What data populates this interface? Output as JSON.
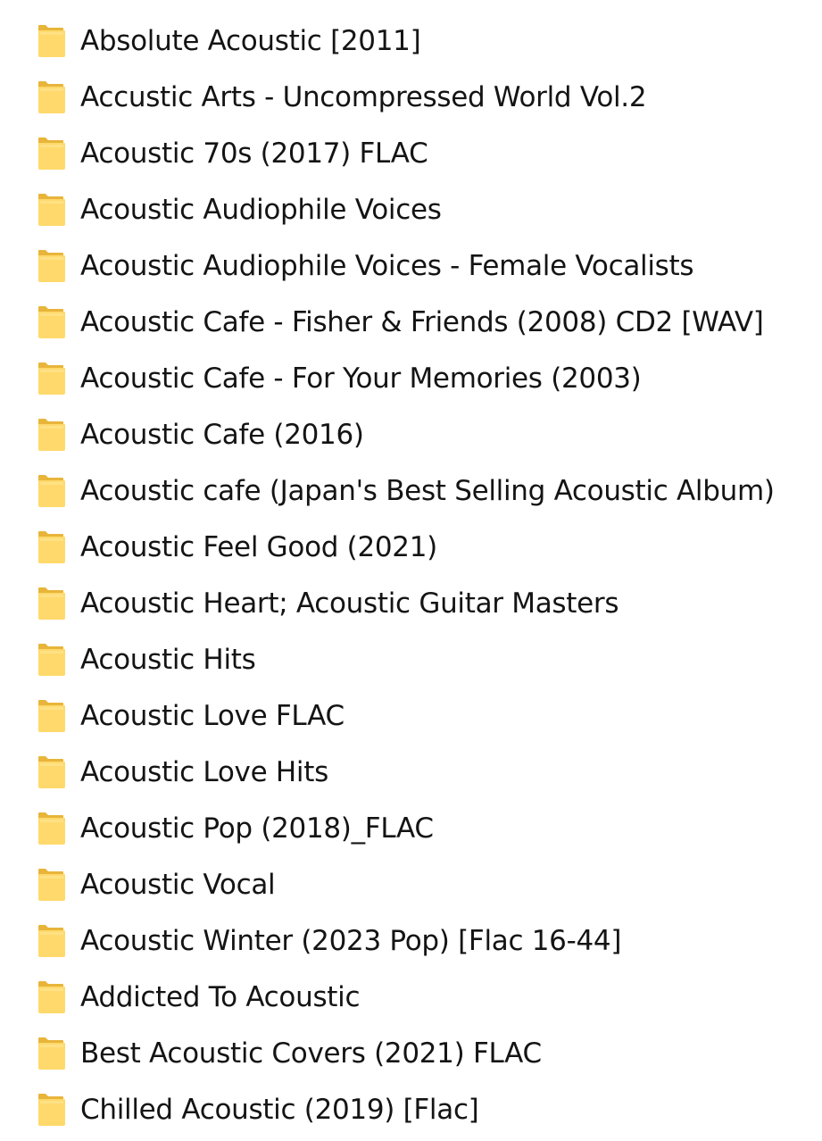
{
  "folders": [
    {
      "name": "Absolute Acoustic [2011]",
      "icon": "folder-icon"
    },
    {
      "name": "Accustic Arts - Uncompressed World Vol.2",
      "icon": "folder-icon"
    },
    {
      "name": "Acoustic 70s (2017) FLAC",
      "icon": "folder-icon"
    },
    {
      "name": "Acoustic Audiophile Voices",
      "icon": "folder-icon"
    },
    {
      "name": "Acoustic Audiophile Voices  - Female Vocalists",
      "icon": "folder-icon"
    },
    {
      "name": "Acoustic Cafe - Fisher & Friends (2008) CD2 [WAV]",
      "icon": "folder-icon"
    },
    {
      "name": "Acoustic Cafe - For Your Memories (2003)",
      "icon": "folder-icon"
    },
    {
      "name": "Acoustic Cafe (2016)",
      "icon": "folder-icon"
    },
    {
      "name": "Acoustic cafe (Japan's Best Selling Acoustic Album)",
      "icon": "folder-icon"
    },
    {
      "name": "Acoustic Feel Good (2021)",
      "icon": "folder-icon"
    },
    {
      "name": "Acoustic Heart; Acoustic Guitar Masters",
      "icon": "folder-icon"
    },
    {
      "name": "Acoustic Hits",
      "icon": "folder-icon"
    },
    {
      "name": "Acoustic Love FLAC",
      "icon": "folder-icon"
    },
    {
      "name": "Acoustic Love Hits",
      "icon": "folder-icon"
    },
    {
      "name": "Acoustic Pop (2018)_FLAC",
      "icon": "folder-icon"
    },
    {
      "name": "Acoustic Vocal",
      "icon": "folder-icon"
    },
    {
      "name": "Acoustic Winter (2023 Pop) [Flac 16-44]",
      "icon": "folder-icon"
    },
    {
      "name": "Addicted To Acoustic",
      "icon": "folder-icon"
    },
    {
      "name": "Best Acoustic Covers (2021) FLAC",
      "icon": "folder-icon"
    },
    {
      "name": "Chilled Acoustic (2019) [Flac]",
      "icon": "folder-icon"
    }
  ],
  "colors": {
    "folder_back": "#E8B53A",
    "folder_front": "#FFD96B",
    "folder_front_light": "#FFE89A",
    "text": "#141414",
    "background": "#FFFFFF"
  }
}
